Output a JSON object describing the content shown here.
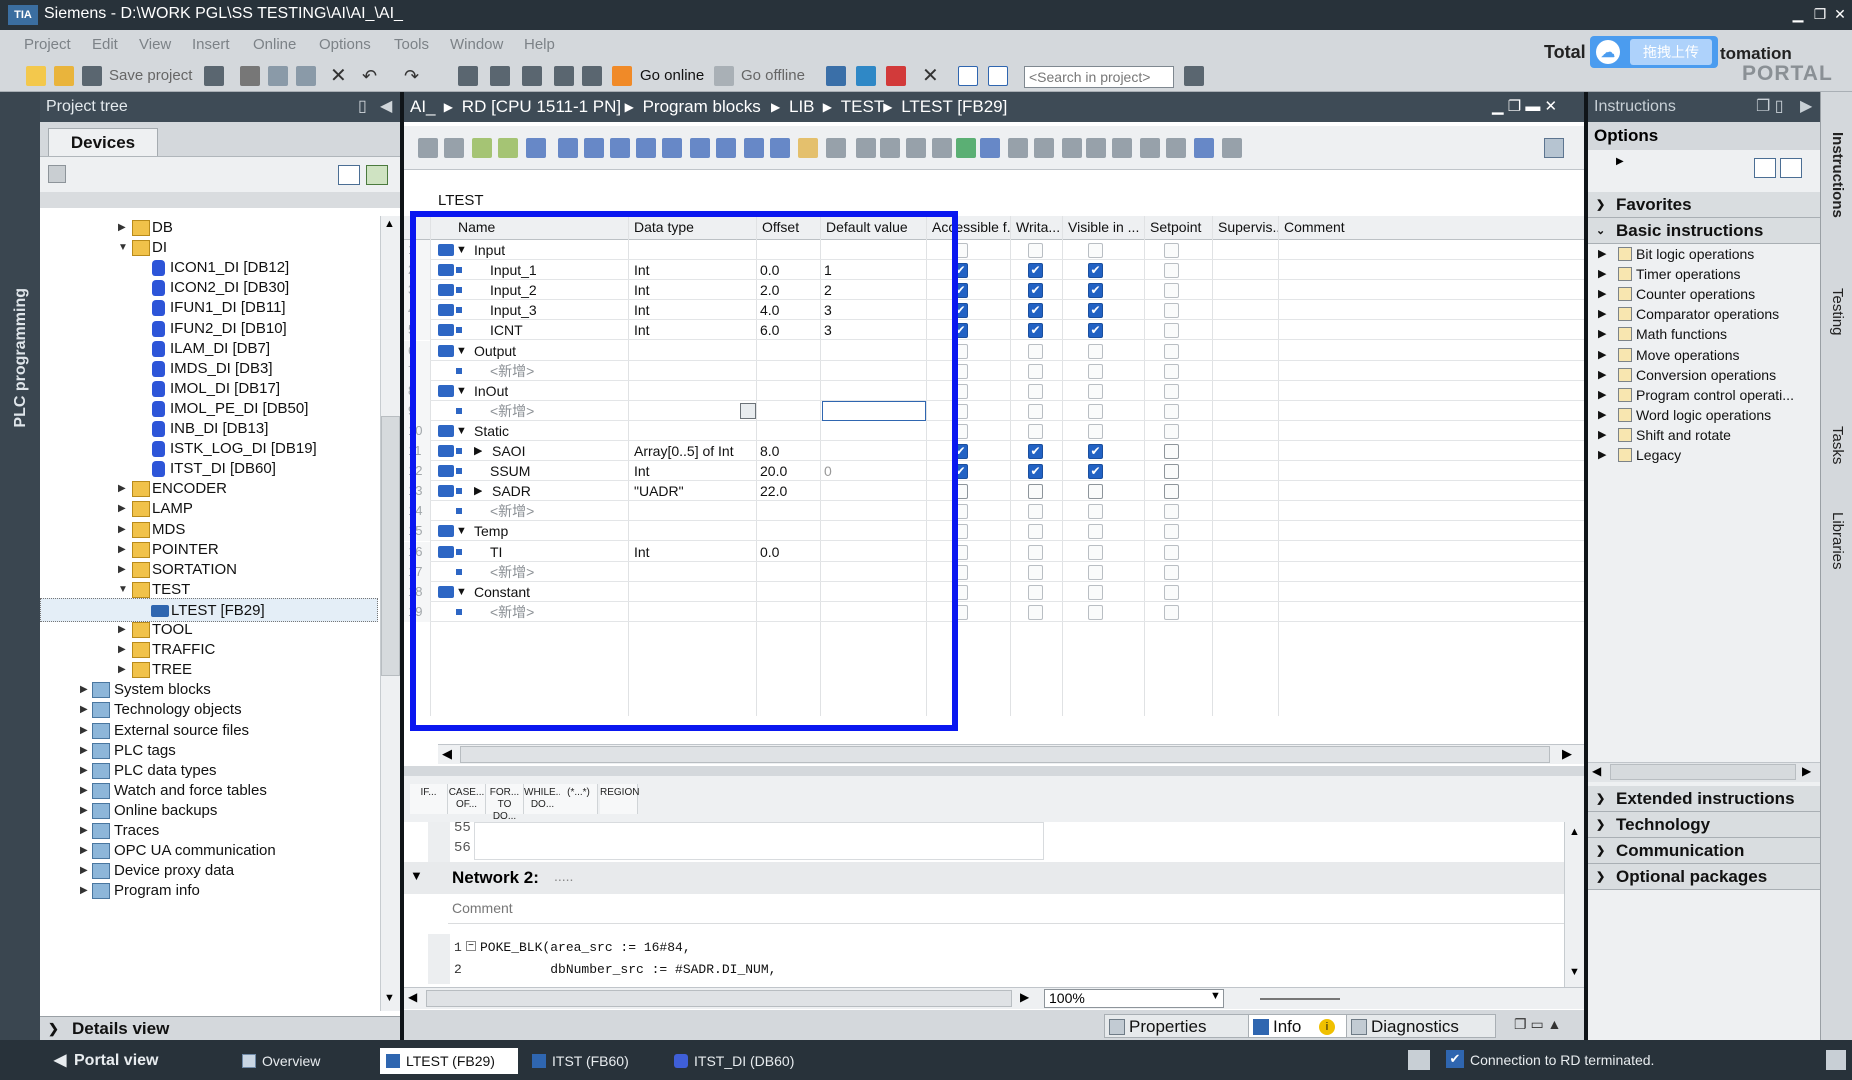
{
  "title_bar": {
    "logo": "TIA",
    "title": "Siemens  -  D:\\WORK PGL\\SS TESTING\\AI\\AI_\\AI_"
  },
  "menu": [
    "Project",
    "Edit",
    "View",
    "Insert",
    "Online",
    "Options",
    "Tools",
    "Window",
    "Help"
  ],
  "toolbar": {
    "save_project": "Save project",
    "go_online": "Go online",
    "go_offline": "Go offline",
    "search_placeholder": "<Search in project>"
  },
  "brand": {
    "total": "Total",
    "automation": "tomation",
    "portal": "PORTAL",
    "cloud_button": "拖拽上传"
  },
  "left_strip": {
    "label": "PLC programming"
  },
  "project_tree": {
    "header": "Project tree",
    "devices_tab": "Devices",
    "items": [
      {
        "label": "DB",
        "type": "folder",
        "expanded": false
      },
      {
        "label": "DI",
        "type": "folder",
        "expanded": true
      },
      {
        "label": "ICON1_DI [DB12]",
        "type": "db"
      },
      {
        "label": "ICON2_DI [DB30]",
        "type": "db"
      },
      {
        "label": "IFUN1_DI [DB11]",
        "type": "db"
      },
      {
        "label": "IFUN2_DI [DB10]",
        "type": "db"
      },
      {
        "label": "ILAM_DI [DB7]",
        "type": "db"
      },
      {
        "label": "IMDS_DI [DB3]",
        "type": "db"
      },
      {
        "label": "IMOL_DI [DB17]",
        "type": "db"
      },
      {
        "label": "IMOL_PE_DI [DB50]",
        "type": "db"
      },
      {
        "label": "INB_DI [DB13]",
        "type": "db"
      },
      {
        "label": "ISTK_LOG_DI [DB19]",
        "type": "db"
      },
      {
        "label": "ITST_DI [DB60]",
        "type": "db"
      },
      {
        "label": "ENCODER",
        "type": "folder",
        "expanded": false
      },
      {
        "label": "LAMP",
        "type": "folder",
        "expanded": false
      },
      {
        "label": "MDS",
        "type": "folder",
        "expanded": false
      },
      {
        "label": "POINTER",
        "type": "folder",
        "expanded": false
      },
      {
        "label": "SORTATION",
        "type": "folder",
        "expanded": false
      },
      {
        "label": "TEST",
        "type": "folder",
        "expanded": true
      },
      {
        "label": "LTEST [FB29]",
        "type": "fb",
        "selected": true
      },
      {
        "label": "TOOL",
        "type": "folder",
        "expanded": false
      },
      {
        "label": "TRAFFIC",
        "type": "folder",
        "expanded": false
      },
      {
        "label": "TREE",
        "type": "folder",
        "expanded": false
      },
      {
        "label": "System blocks",
        "type": "gen",
        "expanded": false
      },
      {
        "label": "Technology objects",
        "type": "gen",
        "expanded": false
      },
      {
        "label": "External source files",
        "type": "gen",
        "expanded": false
      },
      {
        "label": "PLC tags",
        "type": "gen",
        "expanded": false
      },
      {
        "label": "PLC data types",
        "type": "gen",
        "expanded": false
      },
      {
        "label": "Watch and force tables",
        "type": "gen",
        "expanded": false
      },
      {
        "label": "Online backups",
        "type": "gen",
        "expanded": false
      },
      {
        "label": "Traces",
        "type": "gen",
        "expanded": false
      },
      {
        "label": "OPC UA communication",
        "type": "gen",
        "expanded": false
      },
      {
        "label": "Device proxy data",
        "type": "gen",
        "expanded": false
      },
      {
        "label": "Program info",
        "type": "gen",
        "expanded": false
      }
    ],
    "details_view": "Details view"
  },
  "breadcrumb": [
    "AI_",
    "RD [CPU 1511-1 PN]",
    "Program blocks",
    "LIB",
    "TEST",
    "LTEST [FB29]"
  ],
  "block_name": "LTEST",
  "interface": {
    "columns": [
      "Name",
      "Data type",
      "Offset",
      "Default value",
      "Accessible f...",
      "Writa...",
      "Visible in ...",
      "Setpoint",
      "Supervis...",
      "Comment"
    ],
    "rows": [
      {
        "n": "1",
        "name": "Input",
        "kind": "section",
        "type": "",
        "offset": "",
        "default": "",
        "acc": 0,
        "wri": 0,
        "vis": 0,
        "set": 0
      },
      {
        "n": "2",
        "name": "Input_1",
        "kind": "var",
        "type": "Int",
        "offset": "0.0",
        "default": "1",
        "acc": 1,
        "wri": 1,
        "vis": 1,
        "set": 0
      },
      {
        "n": "3",
        "name": "Input_2",
        "kind": "var",
        "type": "Int",
        "offset": "2.0",
        "default": "2",
        "acc": 1,
        "wri": 1,
        "vis": 1,
        "set": 0
      },
      {
        "n": "4",
        "name": "Input_3",
        "kind": "var",
        "type": "Int",
        "offset": "4.0",
        "default": "3",
        "acc": 1,
        "wri": 1,
        "vis": 1,
        "set": 0
      },
      {
        "n": "5",
        "name": "ICNT",
        "kind": "var",
        "type": "Int",
        "offset": "6.0",
        "default": "3",
        "acc": 1,
        "wri": 1,
        "vis": 1,
        "set": 0
      },
      {
        "n": "6",
        "name": "Output",
        "kind": "section",
        "type": "",
        "offset": "",
        "default": "",
        "acc": 0,
        "wri": 0,
        "vis": 0,
        "set": 0
      },
      {
        "n": "7",
        "name": "<新增>",
        "kind": "new",
        "type": "",
        "offset": "",
        "default": "",
        "acc": 0,
        "wri": 0,
        "vis": 0,
        "set": 0
      },
      {
        "n": "8",
        "name": "InOut",
        "kind": "section",
        "type": "",
        "offset": "",
        "default": "",
        "acc": 0,
        "wri": 0,
        "vis": 0,
        "set": 0
      },
      {
        "n": "9",
        "name": "<新增>",
        "kind": "new",
        "type": "",
        "offset": "",
        "default": "",
        "acc": 0,
        "wri": 0,
        "vis": 0,
        "set": 0
      },
      {
        "n": "10",
        "name": "Static",
        "kind": "section",
        "type": "",
        "offset": "",
        "default": "",
        "acc": 0,
        "wri": 0,
        "vis": 0,
        "set": 0
      },
      {
        "n": "11",
        "name": "SAOI",
        "kind": "struct",
        "type": "Array[0..5] of Int",
        "offset": "8.0",
        "default": "",
        "acc": 1,
        "wri": 1,
        "vis": 1,
        "set": 0
      },
      {
        "n": "12",
        "name": "SSUM",
        "kind": "var",
        "type": "Int",
        "offset": "20.0",
        "default": "0",
        "acc": 1,
        "wri": 1,
        "vis": 1,
        "set": 0
      },
      {
        "n": "13",
        "name": "SADR",
        "kind": "struct",
        "type": "\"UADR\"",
        "offset": "22.0",
        "default": "",
        "acc": 0,
        "wri": 0,
        "vis": 0,
        "set": 0
      },
      {
        "n": "14",
        "name": "<新增>",
        "kind": "new",
        "type": "",
        "offset": "",
        "default": "",
        "acc": 0,
        "wri": 0,
        "vis": 0,
        "set": 0
      },
      {
        "n": "15",
        "name": "Temp",
        "kind": "section",
        "type": "",
        "offset": "",
        "default": "",
        "acc": 0,
        "wri": 0,
        "vis": 0,
        "set": 0
      },
      {
        "n": "16",
        "name": "TI",
        "kind": "var",
        "type": "Int",
        "offset": "0.0",
        "default": "",
        "acc": 0,
        "wri": 0,
        "vis": 0,
        "set": 0
      },
      {
        "n": "17",
        "name": "<新增>",
        "kind": "new",
        "type": "",
        "offset": "",
        "default": "",
        "acc": 0,
        "wri": 0,
        "vis": 0,
        "set": 0
      },
      {
        "n": "18",
        "name": "Constant",
        "kind": "section",
        "type": "",
        "offset": "",
        "default": "",
        "acc": 0,
        "wri": 0,
        "vis": 0,
        "set": 0
      },
      {
        "n": "19",
        "name": "<新增>",
        "kind": "new",
        "type": "",
        "offset": "",
        "default": "",
        "acc": 0,
        "wri": 0,
        "vis": 0,
        "set": 0
      }
    ]
  },
  "scl_toolbar": [
    "IF...",
    "CASE... OF...",
    "FOR... TO DO...",
    "WHILE... DO...",
    "(*...*)",
    "REGION"
  ],
  "scl": {
    "prev_lines": [
      "55",
      "56"
    ],
    "network_title": "Network 2:",
    "network_dots": ".....",
    "comment": "Comment",
    "code_lines": [
      {
        "no": "1",
        "text": "POKE_BLK(area_src := 16#84,"
      },
      {
        "no": "2",
        "text": "         dbNumber_src := #SADR.DI_NUM,"
      }
    ],
    "zoom": "100%"
  },
  "instructions": {
    "header": "Instructions",
    "options": "Options",
    "favorites": "Favorites",
    "basic": "Basic instructions",
    "basic_items": [
      "Bit logic operations",
      "Timer operations",
      "Counter operations",
      "Comparator operations",
      "Math functions",
      "Move operations",
      "Conversion operations",
      "Program control operati...",
      "Word logic operations",
      "Shift and rotate",
      "Legacy"
    ],
    "sections": [
      "Extended instructions",
      "Technology",
      "Communication",
      "Optional packages"
    ]
  },
  "right_strip": [
    "Instructions",
    "Testing",
    "Tasks",
    "Libraries"
  ],
  "bottom_tabs": {
    "properties": "Properties",
    "info": "Info",
    "diagnostics": "Diagnostics"
  },
  "taskbar": {
    "portal_view": "Portal view",
    "tasks": [
      "Overview",
      "LTEST (FB29)",
      "ITST (FB60)",
      "ITST_DI (DB60)"
    ],
    "status": "Connection to RD terminated."
  },
  "colors": {
    "highlight_box": "#0a17f0",
    "checkbox_on": "#2262c4",
    "header_dark": "#3e4b56"
  }
}
